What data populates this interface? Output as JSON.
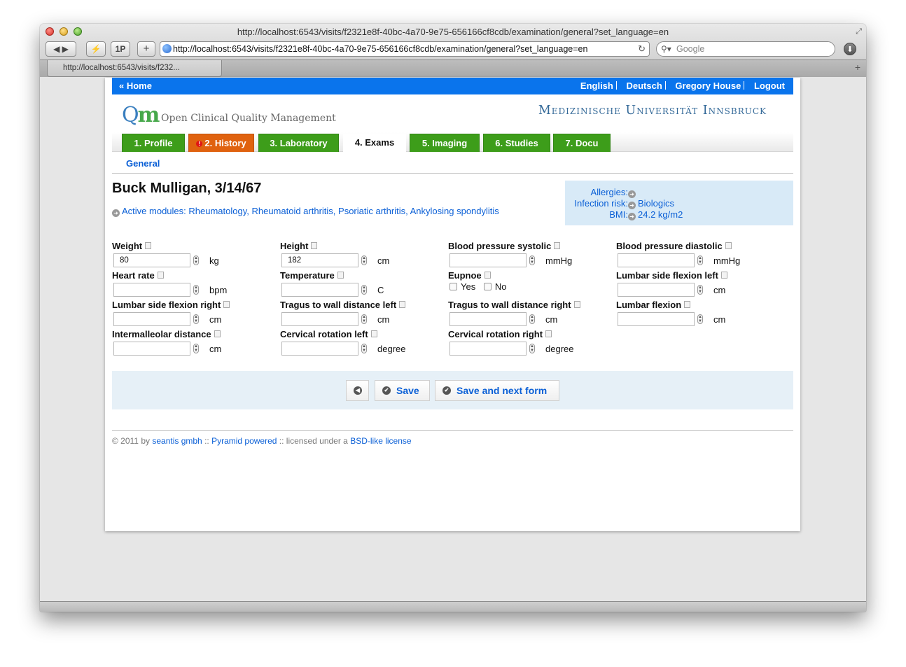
{
  "browser": {
    "window_title": "http://localhost:6543/visits/f2321e8f-40bc-4a70-9e75-656166cf8cdb/examination/general?set_language=en",
    "url": "http://localhost:6543/visits/f2321e8f-40bc-4a70-9e75-656166cf8cdb/examination/general?set_language=en",
    "search_placeholder": "Google",
    "tab_label": "http://localhost:6543/visits/f232...",
    "back_label": "◀",
    "forward_label": "▶",
    "bookmarks_label": "⚡",
    "onepassword_label": "1P",
    "add_label": "+"
  },
  "topnav": {
    "home": "« Home",
    "links": [
      "English",
      "Deutsch",
      "Gregory House",
      "Logout"
    ]
  },
  "branding": {
    "app_name": "Open Clinical Quality Management",
    "university": "Medizinische Universität Innsbruck"
  },
  "tabs": [
    {
      "label": "1. Profile",
      "color": "#3d9d1a"
    },
    {
      "label": "2. History",
      "color": "#e0620f",
      "warning": true
    },
    {
      "label": "3. Laboratory",
      "color": "#3d9d1a"
    },
    {
      "label": "4. Exams",
      "active": true
    },
    {
      "label": "5. Imaging",
      "color": "#3d9d1a"
    },
    {
      "label": "6. Studies",
      "color": "#3d9d1a"
    },
    {
      "label": "7. Docu",
      "color": "#3d9d1a"
    }
  ],
  "subnav": {
    "general": "General"
  },
  "patient": {
    "heading": "Buck Mulligan, 3/14/67",
    "modules_label": "Active modules:",
    "modules": "Rheumatology, Rheumatoid arthritis, Psoriatic arthritis, Ankylosing spondylitis"
  },
  "info": {
    "allergies_label": "Allergies:",
    "infection_label": "Infection risk:",
    "infection_value": "Biologics",
    "bmi_label": "BMI:",
    "bmi_value": "24.2 kg/m2"
  },
  "fields": {
    "weight": {
      "label": "Weight",
      "value": "80",
      "unit": "kg"
    },
    "height": {
      "label": "Height",
      "value": "182",
      "unit": "cm"
    },
    "bp_sys": {
      "label": "Blood pressure systolic",
      "value": "",
      "unit": "mmHg"
    },
    "bp_dia": {
      "label": "Blood pressure diastolic",
      "value": "",
      "unit": "mmHg"
    },
    "heart_rate": {
      "label": "Heart rate",
      "value": "",
      "unit": "bpm"
    },
    "temperature": {
      "label": "Temperature",
      "value": "",
      "unit": "C"
    },
    "eupnoe": {
      "label": "Eupnoe",
      "yes": "Yes",
      "no": "No"
    },
    "lumbar_left": {
      "label": "Lumbar side flexion left",
      "value": "",
      "unit": "cm"
    },
    "lumbar_right": {
      "label": "Lumbar side flexion right",
      "value": "",
      "unit": "cm"
    },
    "tragus_left": {
      "label": "Tragus to wall distance left",
      "value": "",
      "unit": "cm"
    },
    "tragus_right": {
      "label": "Tragus to wall distance right",
      "value": "",
      "unit": "cm"
    },
    "lumbar_flexion": {
      "label": "Lumbar flexion",
      "value": "",
      "unit": "cm"
    },
    "intermalleolar": {
      "label": "Intermalleolar distance",
      "value": "",
      "unit": "cm"
    },
    "cervical_left": {
      "label": "Cervical rotation left",
      "value": "",
      "unit": "degree"
    },
    "cervical_right": {
      "label": "Cervical rotation right",
      "value": "",
      "unit": "degree"
    }
  },
  "actions": {
    "save": "Save",
    "save_next": "Save and next form"
  },
  "footer": {
    "prefix": "© 2011 by",
    "company": "seantis gmbh",
    "sep1": "::",
    "pyramid": "Pyramid powered",
    "sep2": ":: licensed under a",
    "license": "BSD-like license"
  }
}
